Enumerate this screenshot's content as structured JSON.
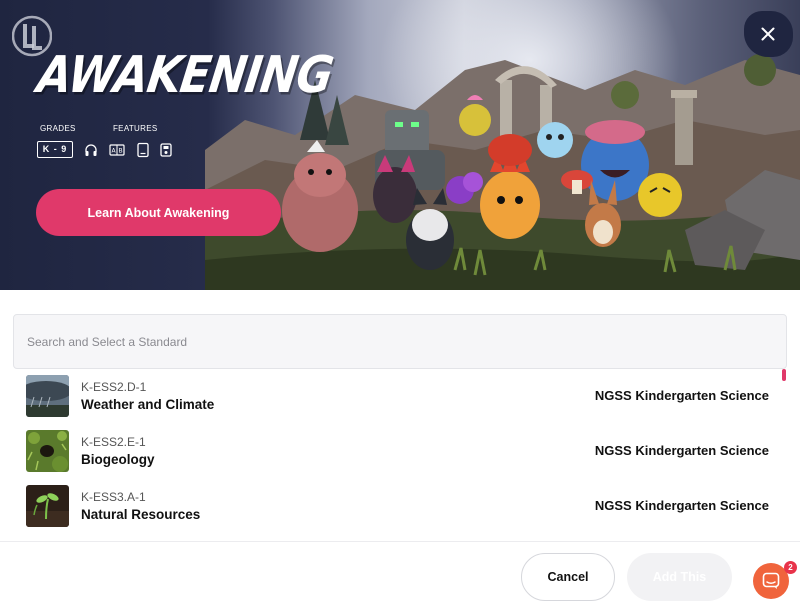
{
  "hero": {
    "title": "AWAKENING",
    "grades_label": "GRADES",
    "grades_value": "K - 9",
    "features_label": "FEATURES",
    "features": [
      {
        "icon": "headphones-icon"
      },
      {
        "icon": "ab-translate-icon"
      },
      {
        "icon": "tablet-icon"
      },
      {
        "icon": "save-icon"
      }
    ],
    "learn_button_label": "Learn About Awakening",
    "accent_color": "#e0396a",
    "close_icon": "close-icon"
  },
  "search": {
    "placeholder": "Search and Select a Standard"
  },
  "standards": [
    {
      "code": "K-ESS2.D-1",
      "name": "Weather and Climate",
      "set": "NGSS Kindergarten Science",
      "thumb": "storm-clouds"
    },
    {
      "code": "K-ESS2.E-1",
      "name": "Biogeology",
      "set": "NGSS Kindergarten Science",
      "thumb": "burrow-in-grass"
    },
    {
      "code": "K-ESS3.A-1",
      "name": "Natural Resources",
      "set": "NGSS Kindergarten Science",
      "thumb": "seedling-sprout"
    }
  ],
  "footer": {
    "cancel_label": "Cancel",
    "add_label": "Add This",
    "chat_badge": "2",
    "chat_color": "#f0643c"
  }
}
